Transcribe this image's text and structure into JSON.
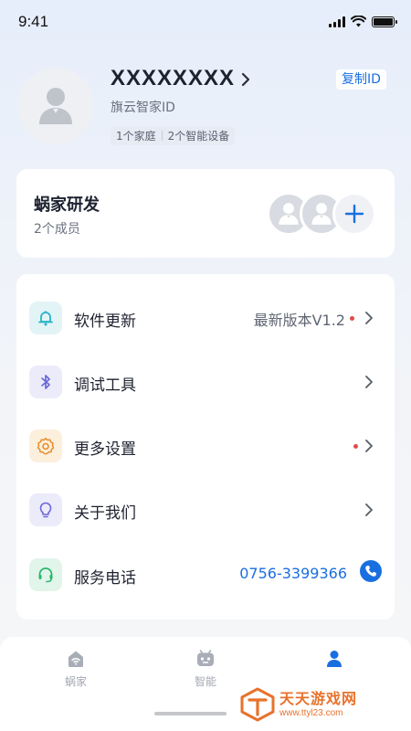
{
  "status_bar": {
    "time": "9:41"
  },
  "profile": {
    "name": "XXXXXXXX",
    "subtitle": "旗云智家ID",
    "tags": [
      "1个家庭",
      "2个智能设备"
    ],
    "copy_id_label": "复制ID"
  },
  "family": {
    "title": "蜗家研发",
    "members_count": "2个成员"
  },
  "menu": {
    "items": [
      {
        "label": "软件更新",
        "value": "最新版本V1.2",
        "icon": "bell-icon",
        "has_dot": true
      },
      {
        "label": "调试工具",
        "value": "",
        "icon": "bluetooth-icon",
        "has_dot": false
      },
      {
        "label": "更多设置",
        "value": "",
        "icon": "gear-icon",
        "has_dot": true
      },
      {
        "label": "关于我们",
        "value": "",
        "icon": "lightbulb-icon",
        "has_dot": false
      },
      {
        "label": "服务电话",
        "value": "0756-3399366",
        "icon": "headset-icon",
        "has_dot": false
      }
    ]
  },
  "bottom_nav": {
    "items": [
      {
        "label": "蜗家",
        "icon": "home-icon",
        "active": false
      },
      {
        "label": "智能",
        "icon": "robot-icon",
        "active": false
      },
      {
        "label": "",
        "icon": "profile-icon",
        "active": true
      }
    ]
  },
  "watermark": {
    "title": "天天游戏网",
    "url": "www.ttyl23.com"
  },
  "colors": {
    "accent": "#1a6fe0",
    "dot": "#e24a4a",
    "watermark": "#e8722c"
  }
}
